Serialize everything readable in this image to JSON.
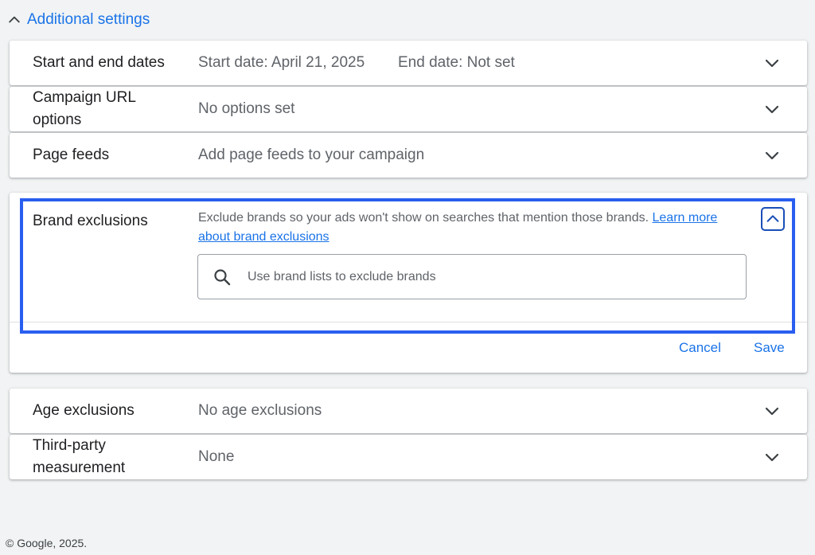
{
  "section": {
    "title": "Additional settings"
  },
  "rows": {
    "dates": {
      "label": "Start and end dates",
      "start": "Start date: April 21, 2025",
      "end": "End date: Not set"
    },
    "url_options": {
      "label": "Campaign URL options",
      "value": "No options set"
    },
    "page_feeds": {
      "label": "Page feeds",
      "value": "Add page feeds to your campaign"
    },
    "age": {
      "label": "Age exclusions",
      "value": "No age exclusions"
    },
    "third_party": {
      "label": "Third-party measurement",
      "value": "None"
    }
  },
  "brand": {
    "label": "Brand exclusions",
    "description": "Exclude brands so your ads won't show on searches that mention those brands.",
    "link": "Learn more about brand exclusions",
    "search_placeholder": "Use brand lists to exclude brands",
    "cancel": "Cancel",
    "save": "Save"
  },
  "footer": {
    "copyright": "© Google, 2025."
  },
  "icons": {
    "expand": "chevron-down-icon",
    "collapse": "chevron-up-icon",
    "search": "search-icon"
  },
  "colors": {
    "accent": "#1a73e8",
    "highlight": "#2a5ef0",
    "text": "#202124",
    "muted": "#5f6368"
  }
}
